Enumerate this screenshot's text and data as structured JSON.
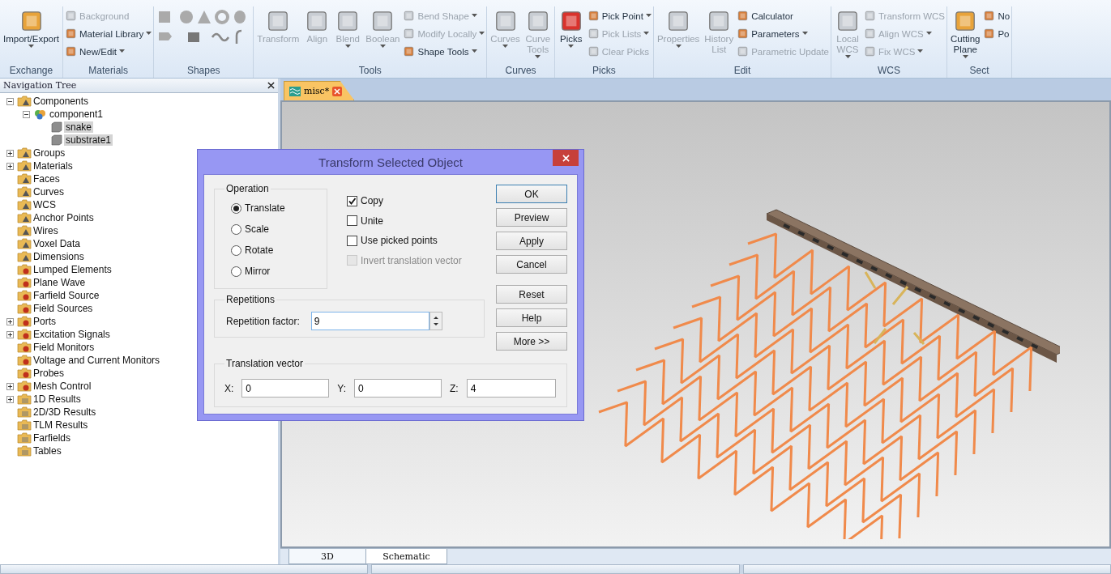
{
  "ribbon": {
    "groups": [
      {
        "label": "Exchange",
        "kind": "buttons",
        "items": [
          {
            "kind": "large",
            "label": "Import/Export",
            "dropdown": true,
            "disabled": false
          }
        ]
      },
      {
        "label": "Materials",
        "kind": "buttons",
        "items": [
          {
            "kind": "small",
            "label": "Background",
            "dropdown": false,
            "disabled": true
          },
          {
            "kind": "small",
            "label": "Material Library",
            "dropdown": true,
            "disabled": false
          },
          {
            "kind": "small",
            "label": "New/Edit",
            "dropdown": true,
            "disabled": false
          }
        ]
      },
      {
        "label": "Shapes",
        "kind": "shapes"
      },
      {
        "label": "Tools",
        "kind": "buttons",
        "items": [
          {
            "kind": "large",
            "label": "Transform",
            "dropdown": false,
            "disabled": true
          },
          {
            "kind": "large",
            "label": "Align",
            "dropdown": false,
            "disabled": true
          },
          {
            "kind": "large",
            "label": "Blend",
            "dropdown": true,
            "disabled": true
          },
          {
            "kind": "large",
            "label": "Boolean",
            "dropdown": true,
            "disabled": true
          },
          {
            "kind": "small",
            "label": "Bend Shape",
            "dropdown": true,
            "disabled": true
          },
          {
            "kind": "small",
            "label": "Modify Locally",
            "dropdown": true,
            "disabled": true
          },
          {
            "kind": "small",
            "label": "Shape Tools",
            "dropdown": true,
            "disabled": false
          }
        ]
      },
      {
        "label": "Curves",
        "kind": "buttons",
        "items": [
          {
            "kind": "large",
            "label": "Curves",
            "dropdown": true,
            "disabled": true
          },
          {
            "kind": "large",
            "label": "Curve Tools",
            "dropdown": true,
            "disabled": true
          }
        ]
      },
      {
        "label": "Picks",
        "kind": "buttons",
        "items": [
          {
            "kind": "large",
            "label": "Picks",
            "dropdown": true,
            "disabled": false
          },
          {
            "kind": "small",
            "label": "Pick Point",
            "dropdown": true,
            "disabled": false
          },
          {
            "kind": "small",
            "label": "Pick Lists",
            "dropdown": true,
            "disabled": true
          },
          {
            "kind": "small",
            "label": "Clear Picks",
            "dropdown": false,
            "disabled": true
          }
        ]
      },
      {
        "label": "Edit",
        "kind": "buttons",
        "items": [
          {
            "kind": "large",
            "label": "Properties",
            "dropdown": true,
            "disabled": true
          },
          {
            "kind": "large",
            "label": "History List",
            "dropdown": false,
            "disabled": true
          },
          {
            "kind": "small",
            "label": "Calculator",
            "dropdown": false,
            "disabled": false
          },
          {
            "kind": "small",
            "label": "Parameters",
            "dropdown": true,
            "disabled": false
          },
          {
            "kind": "small",
            "label": "Parametric Update",
            "dropdown": false,
            "disabled": true
          }
        ]
      },
      {
        "label": "WCS",
        "kind": "buttons",
        "items": [
          {
            "kind": "large",
            "label": "Local WCS",
            "dropdown": true,
            "disabled": true
          },
          {
            "kind": "small",
            "label": "Transform WCS",
            "dropdown": false,
            "disabled": true
          },
          {
            "kind": "small",
            "label": "Align WCS",
            "dropdown": true,
            "disabled": true
          },
          {
            "kind": "small",
            "label": "Fix WCS",
            "dropdown": true,
            "disabled": true
          }
        ]
      },
      {
        "label": "Sect",
        "kind": "buttons",
        "items": [
          {
            "kind": "large",
            "label": "Cutting Plane",
            "dropdown": true,
            "disabled": false
          },
          {
            "kind": "small",
            "label": "No",
            "dropdown": false,
            "disabled": false
          },
          {
            "kind": "small",
            "label": "Po",
            "dropdown": false,
            "disabled": false
          }
        ]
      }
    ]
  },
  "navigation_tree": {
    "title": "Navigation Tree",
    "items": [
      {
        "label": "Components",
        "kind": "folder",
        "expanded": true,
        "selected": false,
        "children": [
          {
            "label": "component1",
            "kind": "component",
            "expanded": true,
            "selected": false,
            "children": [
              {
                "label": "snake",
                "kind": "solid",
                "selected": true
              },
              {
                "label": "substrate1",
                "kind": "solid",
                "selected": true
              }
            ]
          }
        ]
      },
      {
        "label": "Groups",
        "kind": "folder",
        "expanded": false,
        "selected": false
      },
      {
        "label": "Materials",
        "kind": "folder",
        "expanded": false,
        "selected": false
      },
      {
        "label": "Faces",
        "kind": "folder",
        "selected": false
      },
      {
        "label": "Curves",
        "kind": "folder",
        "selected": false
      },
      {
        "label": "WCS",
        "kind": "folder",
        "selected": false
      },
      {
        "label": "Anchor Points",
        "kind": "folder",
        "selected": false
      },
      {
        "label": "Wires",
        "kind": "folder",
        "selected": false
      },
      {
        "label": "Voxel Data",
        "kind": "folder",
        "selected": false
      },
      {
        "label": "Dimensions",
        "kind": "folder",
        "selected": false
      },
      {
        "label": "Lumped Elements",
        "kind": "source",
        "selected": false
      },
      {
        "label": "Plane Wave",
        "kind": "source",
        "selected": false
      },
      {
        "label": "Farfield Source",
        "kind": "source",
        "selected": false
      },
      {
        "label": "Field Sources",
        "kind": "source",
        "selected": false
      },
      {
        "label": "Ports",
        "kind": "source",
        "expanded": false,
        "selected": false
      },
      {
        "label": "Excitation Signals",
        "kind": "source",
        "expanded": false,
        "selected": false
      },
      {
        "label": "Field Monitors",
        "kind": "source",
        "selected": false
      },
      {
        "label": "Voltage and Current Monitors",
        "kind": "source",
        "selected": false
      },
      {
        "label": "Probes",
        "kind": "source",
        "selected": false
      },
      {
        "label": "Mesh Control",
        "kind": "source",
        "expanded": false,
        "selected": false
      },
      {
        "label": "1D Results",
        "kind": "result",
        "expanded": false,
        "selected": false
      },
      {
        "label": "2D/3D Results",
        "kind": "result",
        "selected": false
      },
      {
        "label": "TLM Results",
        "kind": "result",
        "selected": false
      },
      {
        "label": "Farfields",
        "kind": "result",
        "selected": false
      },
      {
        "label": "Tables",
        "kind": "result",
        "selected": false
      }
    ]
  },
  "document_tab": {
    "label": "misc*",
    "selected": true
  },
  "view_tabs": [
    {
      "label": "3D",
      "selected": true
    },
    {
      "label": "Schematic",
      "selected": false
    }
  ],
  "dialog": {
    "title": "Transform Selected Object",
    "operation": {
      "label": "Operation",
      "options": [
        {
          "label": "Translate",
          "selected": true
        },
        {
          "label": "Scale",
          "selected": false
        },
        {
          "label": "Rotate",
          "selected": false
        },
        {
          "label": "Mirror",
          "selected": false
        }
      ]
    },
    "checkboxes": [
      {
        "label": "Copy",
        "checked": true,
        "disabled": false
      },
      {
        "label": "Unite",
        "checked": false,
        "disabled": false
      },
      {
        "label": "Use picked points",
        "checked": false,
        "disabled": false
      },
      {
        "label": "Invert translation vector",
        "checked": false,
        "disabled": true
      }
    ],
    "button_groups": [
      [
        {
          "label": "OK",
          "default": true
        },
        {
          "label": "Preview",
          "default": false
        },
        {
          "label": "Apply",
          "default": false
        },
        {
          "label": "Cancel",
          "default": false
        }
      ],
      [
        {
          "label": "Reset",
          "default": false
        },
        {
          "label": "Help",
          "default": false
        },
        {
          "label": "More >>",
          "default": false
        }
      ]
    ],
    "repetitions": {
      "label": "Repetitions",
      "field_label": "Repetition factor:",
      "value": "9"
    },
    "translation": {
      "label": "Translation vector",
      "fields": [
        {
          "label": "X:",
          "value": "0"
        },
        {
          "label": "Y:",
          "value": "0"
        },
        {
          "label": "Z:",
          "value": "4"
        }
      ]
    }
  }
}
